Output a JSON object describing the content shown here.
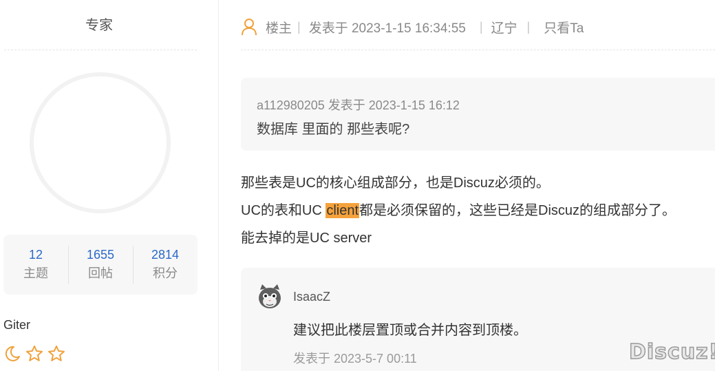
{
  "sidebar": {
    "title": "专家",
    "stats": [
      {
        "value": "12",
        "label": "主题"
      },
      {
        "value": "1655",
        "label": "回帖"
      },
      {
        "value": "2814",
        "label": "积分"
      }
    ],
    "username": "Giter",
    "stars": [
      "moon-icon",
      "star-icon",
      "star-icon"
    ]
  },
  "post_header": {
    "role": "楼主",
    "posted": "发表于 2023-1-15 16:34:55",
    "location": "辽宁",
    "view_only": "只看Ta"
  },
  "quote": {
    "meta": "a112980205 发表于 2023-1-15 16:12",
    "text": "数据库 里面的 那些表呢?"
  },
  "body": {
    "line1": "那些表是UC的核心组成部分，也是Discuz必须的。",
    "line2_pre": "UC的表和UC ",
    "line2_highlight": "client",
    "line2_post": "都是必须保留的，这些已经是Discuz的组成部分了。",
    "line3": "能去掉的是UC server"
  },
  "comment": {
    "user": "IsaacZ",
    "text": "建议把此楼层置顶或合并内容到顶楼。",
    "time": "发表于 2023-5-7 00:11"
  },
  "watermark": "Discuz!",
  "colors": {
    "accent_blue": "#2a68c9",
    "highlight": "#f5a23c",
    "icon_orange": "#f0a13a"
  }
}
